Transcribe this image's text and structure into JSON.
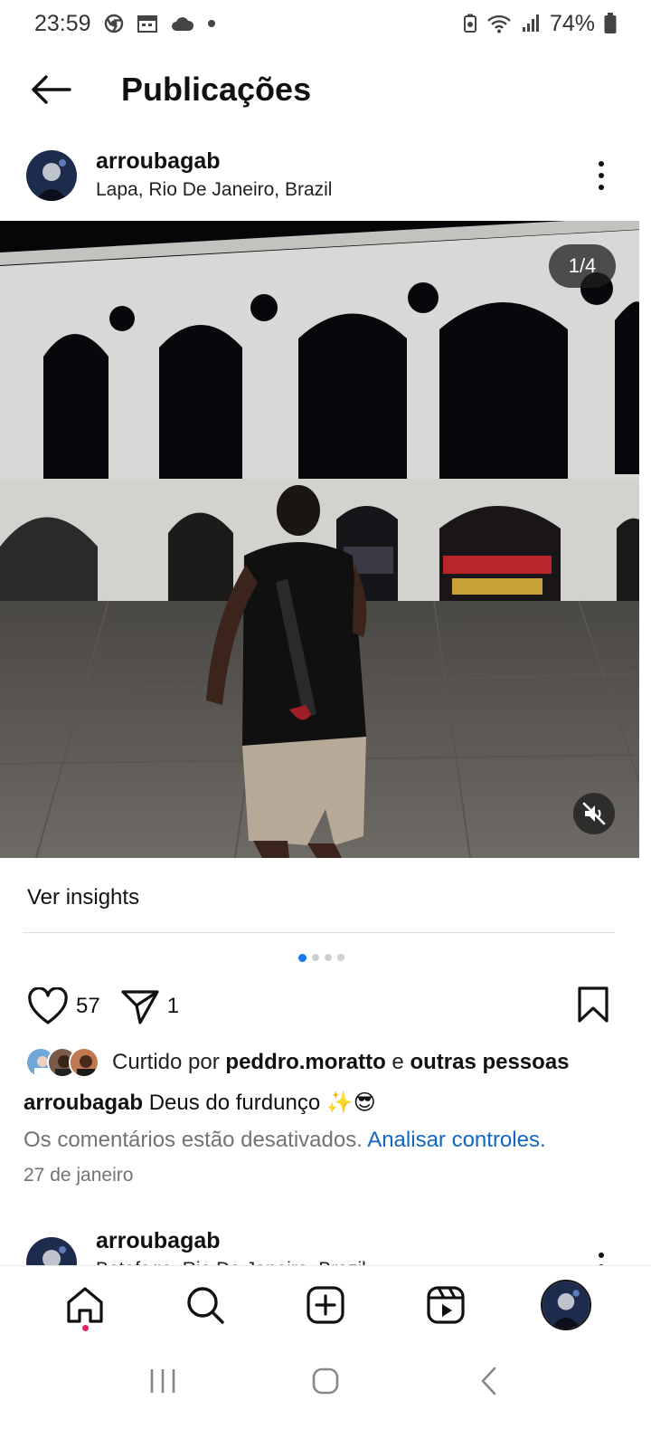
{
  "status_bar": {
    "time": "23:59",
    "battery": "74%",
    "icons": [
      "chrome-icon",
      "calendar-icon",
      "cloud-icon",
      "dot-icon",
      "battery-saver-icon",
      "wifi-icon",
      "signal-icon",
      "battery-icon"
    ]
  },
  "header": {
    "title": "Publicações",
    "back_icon": "arrow-left-icon"
  },
  "post": {
    "username": "arroubagab",
    "location": "Lapa, Rio De Janeiro, Brazil",
    "media_counter": "1/4",
    "insights_label": "Ver insights",
    "carousel_total": 4,
    "carousel_active": 1,
    "like_count": "57",
    "share_count": "1",
    "liked_prefix": "Curtido por",
    "liked_user": "peddro.moratto",
    "liked_connector": "e",
    "liked_others": "outras pessoas",
    "caption_user": "arroubagab",
    "caption_text": "Deus do furdunço ✨😎",
    "comments_disabled": "Os comentários estão desativados.",
    "review_controls": "Analisar controles",
    "date": "27 de janeiro"
  },
  "next_post": {
    "username": "arroubagab",
    "location": "Botafogo, Rio De Janeiro, Brazil"
  },
  "bottom_nav": {
    "items": [
      "home-icon",
      "search-icon",
      "create-icon",
      "reels-icon",
      "profile-avatar"
    ]
  },
  "colors": {
    "link": "#1266c4",
    "active_dot": "#1877f2",
    "notification": "#e0245e",
    "secondary_text": "#737373"
  }
}
